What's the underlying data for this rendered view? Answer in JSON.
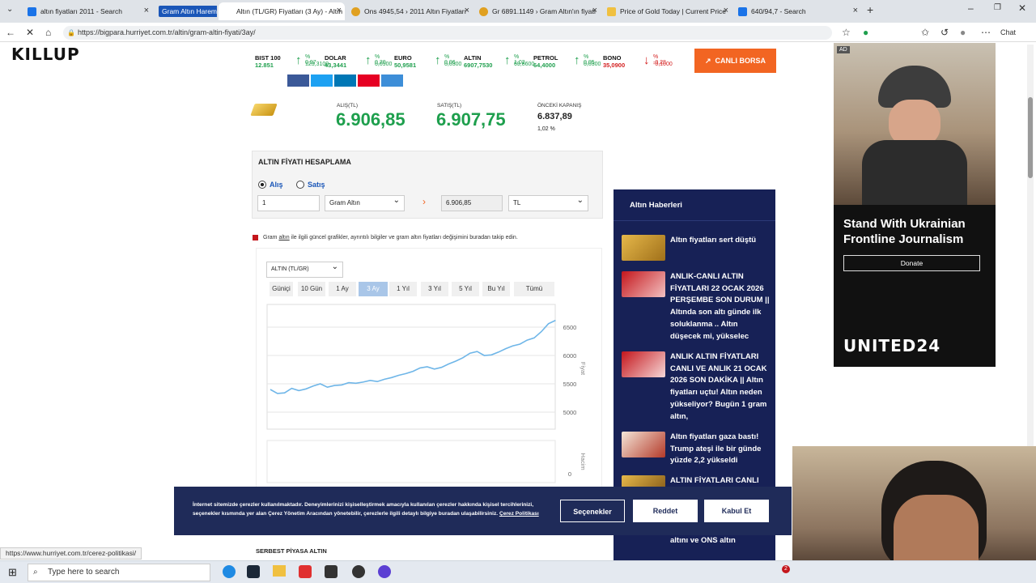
{
  "browser": {
    "tabs": [
      {
        "title": "altın fiyatları 2011 - Search"
      },
      {
        "title": "Gram Altın Harem"
      },
      {
        "title": "Altın (TL/GR) Fiyatları (3 Ay) - Altın"
      },
      {
        "title": "Ons 4945,54 › 2011 Altın Fiyatları"
      },
      {
        "title": "Gr 6891.1149 › Gram Altın'ın fiyatı"
      },
      {
        "title": "Price of Gold Today | Current Price"
      },
      {
        "title": "640/94,7 - Search"
      }
    ],
    "url": "https://bigpara.hurriyet.com.tr/altin/gram-altin-fiyati/3ay/",
    "chat_label": "Chat",
    "status_url": "https://www.hurriyet.com.tr/cerez-politikasi/"
  },
  "page": {
    "logo": "KILLUP",
    "ticker": [
      {
        "name": "BIST 100",
        "value": "12.851",
        "pct": "% 0,97",
        "change": "123,3100",
        "dir": "up"
      },
      {
        "name": "DOLAR",
        "value": "43,3441",
        "pct": "% 0,20",
        "change": "0,0900",
        "dir": "up"
      },
      {
        "name": "EURO",
        "value": "50,9581",
        "pct": "% 0,06",
        "change": "0,0300",
        "dir": "up"
      },
      {
        "name": "ALTIN",
        "value": "6907,7530",
        "pct": "% 1,02",
        "change": "69,8600",
        "dir": "up"
      },
      {
        "name": "PETROL",
        "value": "64,4000",
        "pct": "% 0,05",
        "change": "0,0300",
        "dir": "up"
      },
      {
        "name": "BONO",
        "value": "35,0900",
        "pct": "% -0,28",
        "change": "-0,1000",
        "dir": "down"
      }
    ],
    "canli_borsa": "CANLI BORSA",
    "prices": {
      "alis_label": "ALIŞ(TL)",
      "alis": "6.906,85",
      "satis_label": "SATIŞ(TL)",
      "satis": "6.907,75",
      "onceki_label": "ÖNCEKİ KAPANIŞ",
      "onceki": "6.837,89",
      "change": "1,02 %"
    },
    "calc": {
      "title": "ALTIN FİYATI HESAPLAMA",
      "radio_alis": "Alış",
      "radio_satis": "Satış",
      "qty": "1",
      "type": "Gram Altın",
      "result": "6.906,85",
      "currency": "TL"
    },
    "info_text_prefix": "Gram ",
    "info_text_link": "altın",
    "info_text_suffix": " ile ilgili güncel grafikler, ayrıntılı bilgiler ve gram altın fiyatları değişimini buradan takip edin.",
    "chart_select": "ALTIN (TL/GR)",
    "chart_tabs": [
      "Güniçi",
      "10 Gün",
      "1 Ay",
      "3 Ay",
      "1 Yıl",
      "3 Yıl",
      "5 Yıl",
      "Bu Yıl",
      "Tümü"
    ],
    "active_tab": "3 Ay",
    "price_axis_label": "Fiyat",
    "volume_axis_label": "Hacim",
    "serbest_label": "SERBEST PİYASA ALTIN"
  },
  "chart_data": {
    "type": "line",
    "yticks": [
      5000,
      5500,
      6000,
      6500
    ],
    "ylim": [
      4700,
      6900
    ],
    "volume_ticks": [
      0
    ],
    "series": [
      {
        "values": [
          5400,
          5330,
          5340,
          5420,
          5380,
          5410,
          5460,
          5500,
          5440,
          5470,
          5480,
          5520,
          5510,
          5530,
          5560,
          5540,
          5580,
          5610,
          5650,
          5680,
          5720,
          5780,
          5800,
          5760,
          5790,
          5850,
          5900,
          5960,
          6040,
          6070,
          6000,
          6010,
          6060,
          6120,
          6170,
          6200,
          6270,
          6310,
          6420,
          6560,
          6620
        ]
      }
    ]
  },
  "news": {
    "header": "Altın Haberleri",
    "items": [
      {
        "title": "Altın fiyatları sert düştü"
      },
      {
        "title": "ANLIK-CANLI ALTIN FİYATLARI 22 OCAK 2026 PERŞEMBE SON DURUM || Altında son altı günde ilk soluklanma .. Altın düşecek mi, yükselec"
      },
      {
        "title": "ANLIK ALTIN FİYATLARI CANLI VE ANLIK 21 OCAK 2026 SON DAKİKA || Altın fiyatları uçtu! Altın neden yükseliyor? Bugün 1 gram altın,"
      },
      {
        "title": "Altın fiyatları gaza bastı! Trump ateşi ile bir günde yüzde 2,2 yükseldi"
      },
      {
        "title": "ALTIN FİYATLARI CANLI"
      },
      {
        "title": "altını ve ONS altın"
      }
    ]
  },
  "ad": {
    "badge": "AD",
    "headline": "Stand With Ukrainian Frontline Journalism",
    "button": "Donate",
    "brand": "UNITED24"
  },
  "cookie": {
    "text": "İnternet sitemizde çerezler kullanılmaktadır. Deneyimlerinizi kişiselleştirmek amacıyla kullanılan çerezler hakkında kişisel tercihlerinizi, seçenekler kısmında yer alan Çerez Yönetim Aracından yönetebilir, çerezlerle ilgili detaylı bilgiye buradan ulaşabilirsiniz.",
    "link": "Çerez Politikası",
    "secenekler": "Seçenekler",
    "reddet": "Reddet",
    "kabul": "Kabul Et"
  },
  "taskbar": {
    "search_placeholder": "Type here to search",
    "notif_count": "2"
  }
}
